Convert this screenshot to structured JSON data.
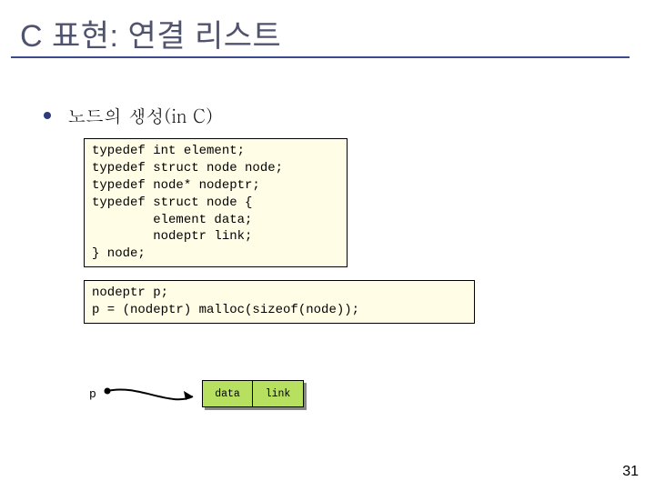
{
  "title": "C 표현: 연결 리스트",
  "bullet": "노드의 생성(in C)",
  "code1": "typedef int element;\ntypedef struct node node;\ntypedef node* nodeptr;\ntypedef struct node {\n        element data;\n        nodeptr link;\n} node;",
  "code2": "nodeptr p;\np = (nodeptr) malloc(sizeof(node));",
  "p_label": "p",
  "node_data": "data",
  "node_link": "link",
  "page_number": "31"
}
